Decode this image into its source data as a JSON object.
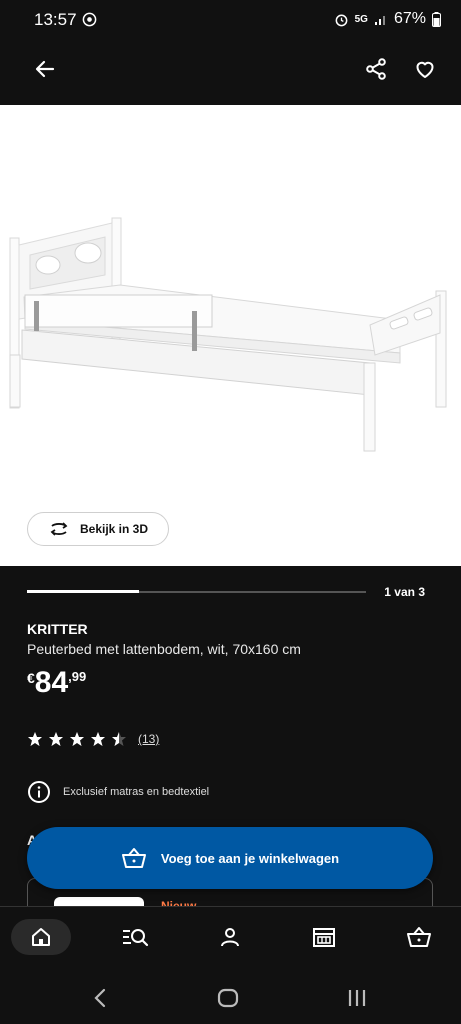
{
  "status_bar": {
    "time": "13:57",
    "network": "5G",
    "battery": "67%"
  },
  "header": {
    "back_icon": "arrow-left-icon",
    "share_icon": "share-icon",
    "favorite_icon": "heart-icon"
  },
  "gallery": {
    "view_3d_label": "Bekijk in 3D",
    "counter": "1 van 3",
    "progress_fraction": 0.33
  },
  "product": {
    "name": "KRITTER",
    "description": "Peuterbed met lattenbodem, wit, 70x160 cm",
    "price_currency": "€",
    "price_integer": "84",
    "price_decimal": ",99",
    "rating_value": 4.5,
    "rating_max": 5,
    "review_count": "(13)",
    "info_note": "Exclusief matras en bedtextiel"
  },
  "section_peek": {
    "text": "A",
    "badge": "Nieuw"
  },
  "cart_button": {
    "label": "Voeg toe aan je winkelwagen"
  },
  "bottom_nav": {
    "items": [
      {
        "name": "home",
        "icon": "home-icon",
        "active": true
      },
      {
        "name": "search",
        "icon": "search-list-icon",
        "active": false
      },
      {
        "name": "profile",
        "icon": "person-icon",
        "active": false
      },
      {
        "name": "stores",
        "icon": "store-icon",
        "active": false
      },
      {
        "name": "cart",
        "icon": "basket-icon",
        "active": false
      }
    ]
  },
  "colors": {
    "background": "#111111",
    "accent_blue": "#0058a3",
    "badge_orange": "#ff7a45"
  }
}
